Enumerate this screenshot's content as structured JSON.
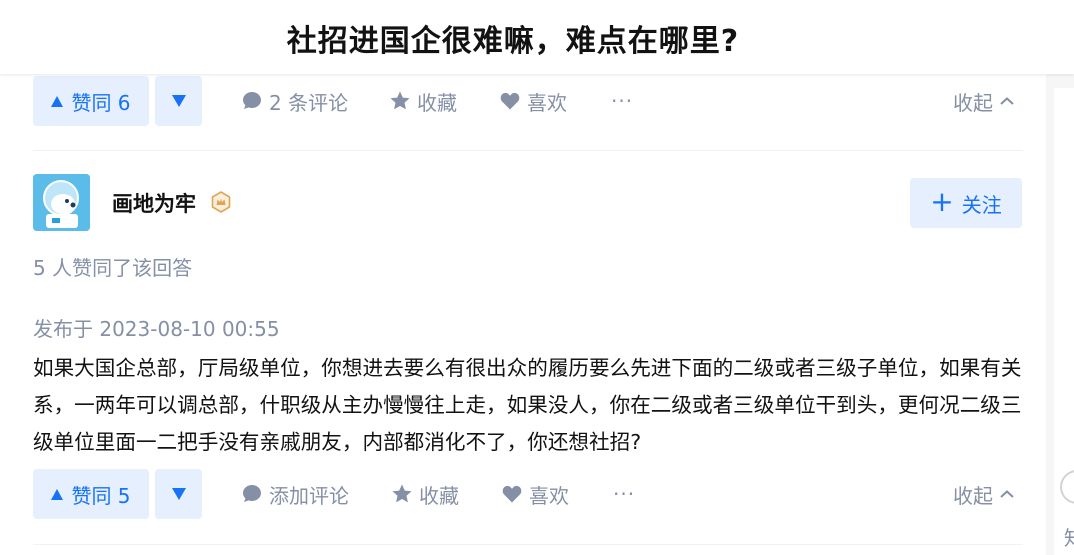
{
  "page": {
    "question_title": "社招进国企很难嘛，难点在哪里?"
  },
  "top_actions": {
    "vote_up": "赞同 6",
    "comments": "2 条评论",
    "favorite": "收藏",
    "like": "喜欢",
    "more": "···",
    "collapse": "收起"
  },
  "answer": {
    "author_name": "画地为牢",
    "follow_label": "关注",
    "follow_plus": "+",
    "vote_summary": "5 人赞同了该回答",
    "publish_time": "发布于 2023-08-10 00:55",
    "content": "如果大国企总部，厅局级单位，你想进去要么有很出众的履历要么先进下面的二级或者三级子单位，如果有关系，一两年可以调总部，什职级从主办慢慢往上走，如果没人，你在二级或者三级单位干到头，更何况二级三级单位里面一二把手没有亲戚朋友，内部都消化不了，你还想社招?",
    "actions": {
      "vote_up": "赞同 5",
      "comments": "添加评论",
      "favorite": "收藏",
      "like": "喜欢",
      "more": "···",
      "collapse": "收起"
    }
  },
  "sidebar": {
    "partial_text": "知"
  },
  "colors": {
    "accent": "#1772f6",
    "accent_bg": "#e5effd",
    "muted": "#8590a6",
    "text": "#121212",
    "badge": "#e0a553"
  }
}
